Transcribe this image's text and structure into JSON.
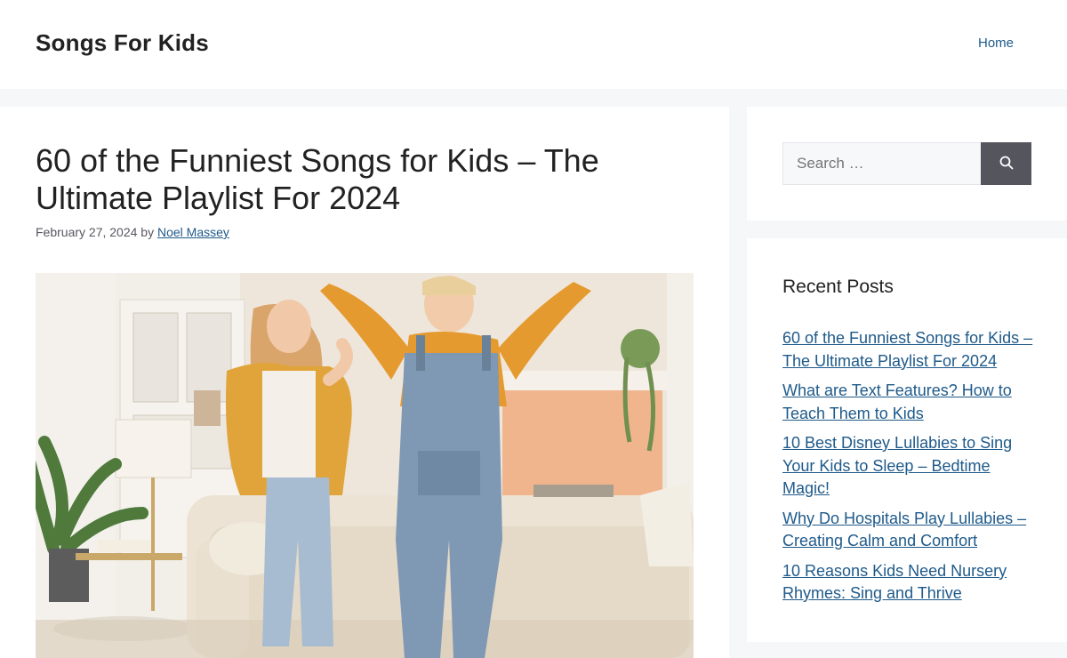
{
  "header": {
    "site_title": "Songs For Kids",
    "nav": [
      {
        "label": "Home"
      }
    ]
  },
  "post": {
    "title": "60 of the Funniest Songs for Kids – The Ultimate Playlist For 2024",
    "date": "February 27, 2024",
    "by_label": "by",
    "author": "Noel Massey",
    "featured_image_alt": "Two children jumping and dancing in a living room"
  },
  "sidebar": {
    "search": {
      "placeholder": "Search …",
      "button_icon": "search-icon"
    },
    "recent_posts": {
      "heading": "Recent Posts",
      "items": [
        {
          "label": "60 of the Funniest Songs for Kids – The Ultimate Playlist For 2024"
        },
        {
          "label": "What are Text Features? How to Teach Them to Kids"
        },
        {
          "label": "10 Best Disney Lullabies to Sing Your Kids to Sleep – Bedtime Magic!"
        },
        {
          "label": "Why Do Hospitals Play Lullabies – Creating Calm and Comfort"
        },
        {
          "label": "10 Reasons Kids Need Nursery Rhymes: Sing and Thrive"
        }
      ]
    }
  },
  "colors": {
    "link": "#1e5a8a",
    "page_background": "#f6f7f9",
    "search_button": "#55555e"
  }
}
